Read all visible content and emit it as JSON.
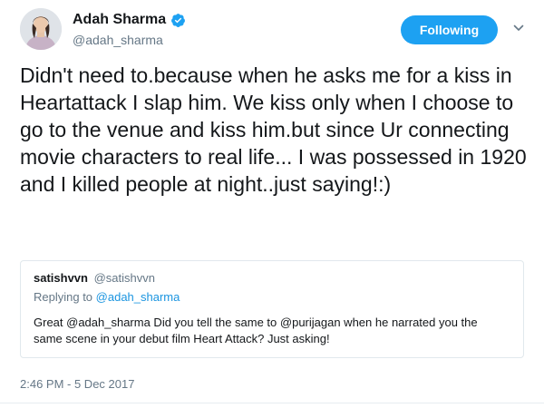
{
  "author": {
    "display_name": "Adah Sharma",
    "handle": "@adah_sharma",
    "verified": true
  },
  "follow_button": {
    "label": "Following",
    "color": "#1da1f2"
  },
  "menu": {
    "icon": "chevron-down-icon"
  },
  "tweet": {
    "text": "Didn't need to.because when he asks me for a kiss in Heartattack I slap him. We kiss only when I choose to go to the venue and kiss him.but since Ur connecting movie characters to real life... I was possessed in 1920 and I killed people at night..just saying!:)",
    "timestamp": "2:46 PM - 5 Dec 2017"
  },
  "quoted_tweet": {
    "name": "satishvvn",
    "handle": "@satishvvn",
    "replying_prefix": "Replying to",
    "replying_to": "@adah_sharma",
    "text": "Great @adah_sharma Did you tell the same to @purijagan when he narrated you the same scene in your debut film Heart Attack? Just asking!"
  },
  "colors": {
    "text": "#14171a",
    "secondary": "#657786",
    "link": "#1b95e0",
    "border": "#e1e8ed"
  }
}
